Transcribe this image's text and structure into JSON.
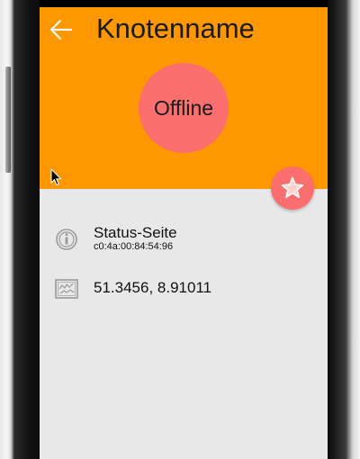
{
  "header": {
    "title": "Knotenname",
    "status": "Offline"
  },
  "details": {
    "status_page_label": "Status-Seite",
    "mac_address": "c0:4a:00:84:54:96",
    "coordinates": "51.3456, 8.91011"
  },
  "icons": {
    "back": "arrow-back-icon",
    "favorite": "star-icon",
    "info": "info-icon",
    "map": "map-icon"
  },
  "colors": {
    "header": "#ff9800",
    "status_offline": "#fb6f6f",
    "background": "#e8e8e8"
  }
}
